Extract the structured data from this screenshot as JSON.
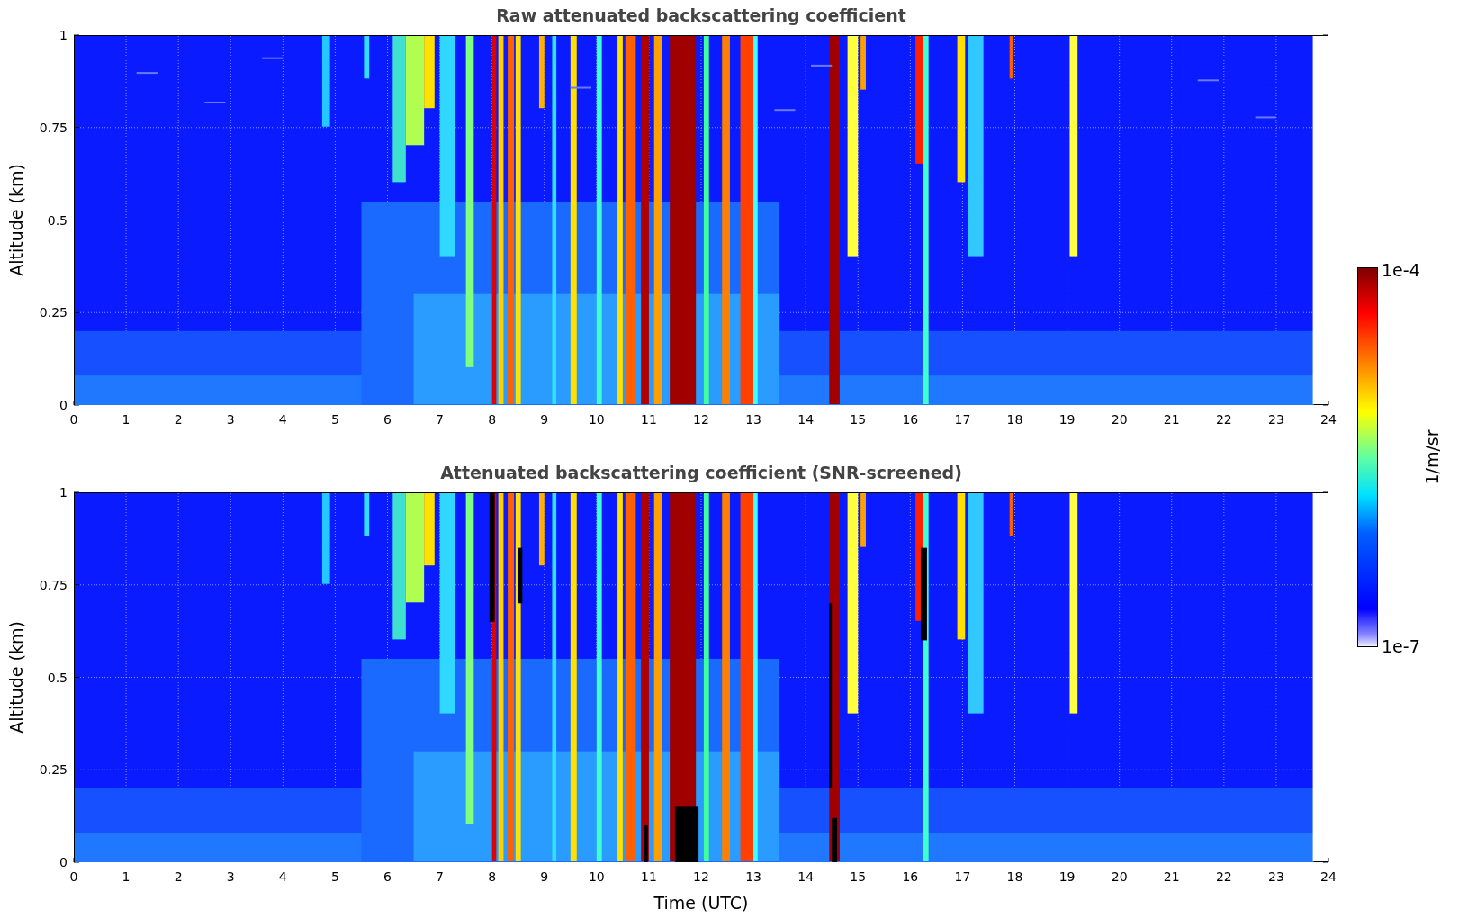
{
  "panels": [
    {
      "kind": "raw",
      "title": "Raw attenuated backscattering coefficient",
      "ylabel": "Altitude (km)",
      "yticks": [
        "1",
        "0.75",
        "0.5",
        "0.25",
        "0"
      ],
      "xticks": [
        "0",
        "1",
        "2",
        "3",
        "4",
        "5",
        "6",
        "7",
        "8",
        "9",
        "10",
        "11",
        "12",
        "13",
        "14",
        "15",
        "16",
        "17",
        "18",
        "19",
        "20",
        "21",
        "22",
        "23",
        "24"
      ]
    },
    {
      "kind": "screened",
      "title": "Attenuated backscattering coefficient (SNR-screened)",
      "ylabel": "Altitude (km)",
      "yticks": [
        "1",
        "0.75",
        "0.5",
        "0.25",
        "0"
      ],
      "xticks": [
        "0",
        "1",
        "2",
        "3",
        "4",
        "5",
        "6",
        "7",
        "8",
        "9",
        "10",
        "11",
        "12",
        "13",
        "14",
        "15",
        "16",
        "17",
        "18",
        "19",
        "20",
        "21",
        "22",
        "23",
        "24"
      ],
      "xlabel": "Time (UTC)"
    }
  ],
  "colorbar": {
    "max": "1e-4",
    "min": "1e-7",
    "label": "1/m/sr"
  }
}
